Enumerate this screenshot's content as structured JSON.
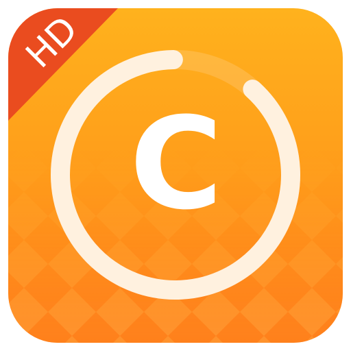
{
  "icon": {
    "badge_text": "HD",
    "logo_letter": "C",
    "semantic": "app-icon-with-copyright-style-c-logo",
    "progress_ring_fraction": 0.88,
    "colors": {
      "bg_top": "#ffb21d",
      "bg_mid": "#ff9a1a",
      "bg_bottom": "#ff7a18",
      "diamond_light": "#ffb34a",
      "diamond_dark": "#ff8a22",
      "ribbon": "#ea4c1f",
      "ring": "#fff1df",
      "letter": "#ffffff",
      "badge_text": "#ffffff"
    }
  }
}
